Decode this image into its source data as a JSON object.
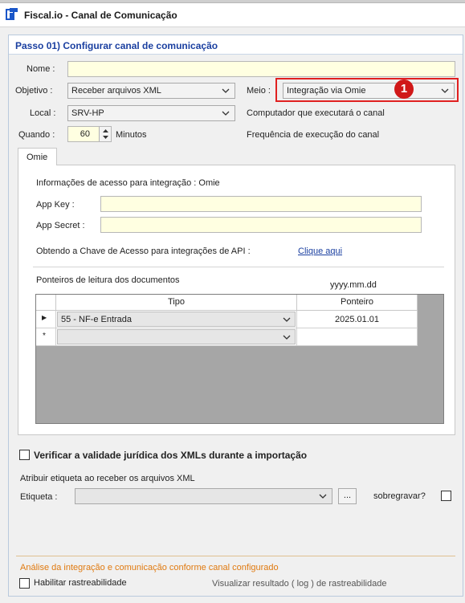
{
  "window": {
    "title": "Fiscal.io - Canal de Comunicação",
    "icon": "app-logo-icon"
  },
  "step": {
    "title": "Passo 01) Configurar canal de comunicação"
  },
  "form": {
    "nome_label": "Nome :",
    "nome_value": "",
    "objetivo_label": "Objetivo :",
    "objetivo_value": "Receber arquivos XML",
    "meio_label": "Meio :",
    "meio_value": "Integração via Omie",
    "local_label": "Local :",
    "local_value": "SRV-HP",
    "local_hint": "Computador que executará o canal",
    "quando_label": "Quando :",
    "quando_value": "60",
    "quando_unit": "Minutos",
    "quando_hint": "Frequência de execução do canal"
  },
  "callout": {
    "number": "1",
    "color": "#d01818"
  },
  "tabs": [
    {
      "label": "Omie",
      "active": true
    }
  ],
  "omie": {
    "info_label": "Informações de acesso para integração : Omie",
    "app_key_label": "App  Key :",
    "app_key_value": "",
    "app_secret_label": "App Secret :",
    "app_secret_value": "",
    "api_text": "Obtendo a Chave de Acesso para integrações de API :",
    "api_link": "Clique aqui",
    "pointers_label": "Ponteiros de leitura dos documentos",
    "date_format": "yyyy.mm.dd"
  },
  "grid": {
    "columns": [
      "Tipo",
      "Ponteiro"
    ],
    "rows": [
      {
        "indicator": "▶",
        "tipo": "55 - NF-e Entrada",
        "ponteiro": "2025.01.01"
      },
      {
        "indicator": "*",
        "tipo": "",
        "ponteiro": ""
      }
    ]
  },
  "validate": {
    "label": "Verificar a validade jurídica dos XMLs durante a importação",
    "checked": false
  },
  "label_section": {
    "title": "Atribuir etiqueta ao receber os arquivos XML",
    "etiqueta_label": "Etiqueta :",
    "etiqueta_value": "",
    "browse_label": "...",
    "overwrite_label": "sobregravar?",
    "overwrite_checked": false
  },
  "analysis": {
    "title": "Análise da integração e comunicação conforme canal configurado",
    "trace_label": "Habilitar rastreabilidade",
    "trace_checked": false,
    "view_label": "Visualizar resultado ( log ) de rastreabilidade"
  },
  "colors": {
    "accent": "#1a3fa0",
    "input_bg": "#ffffe1",
    "highlight": "#e02020",
    "orange": "#e07a10"
  }
}
